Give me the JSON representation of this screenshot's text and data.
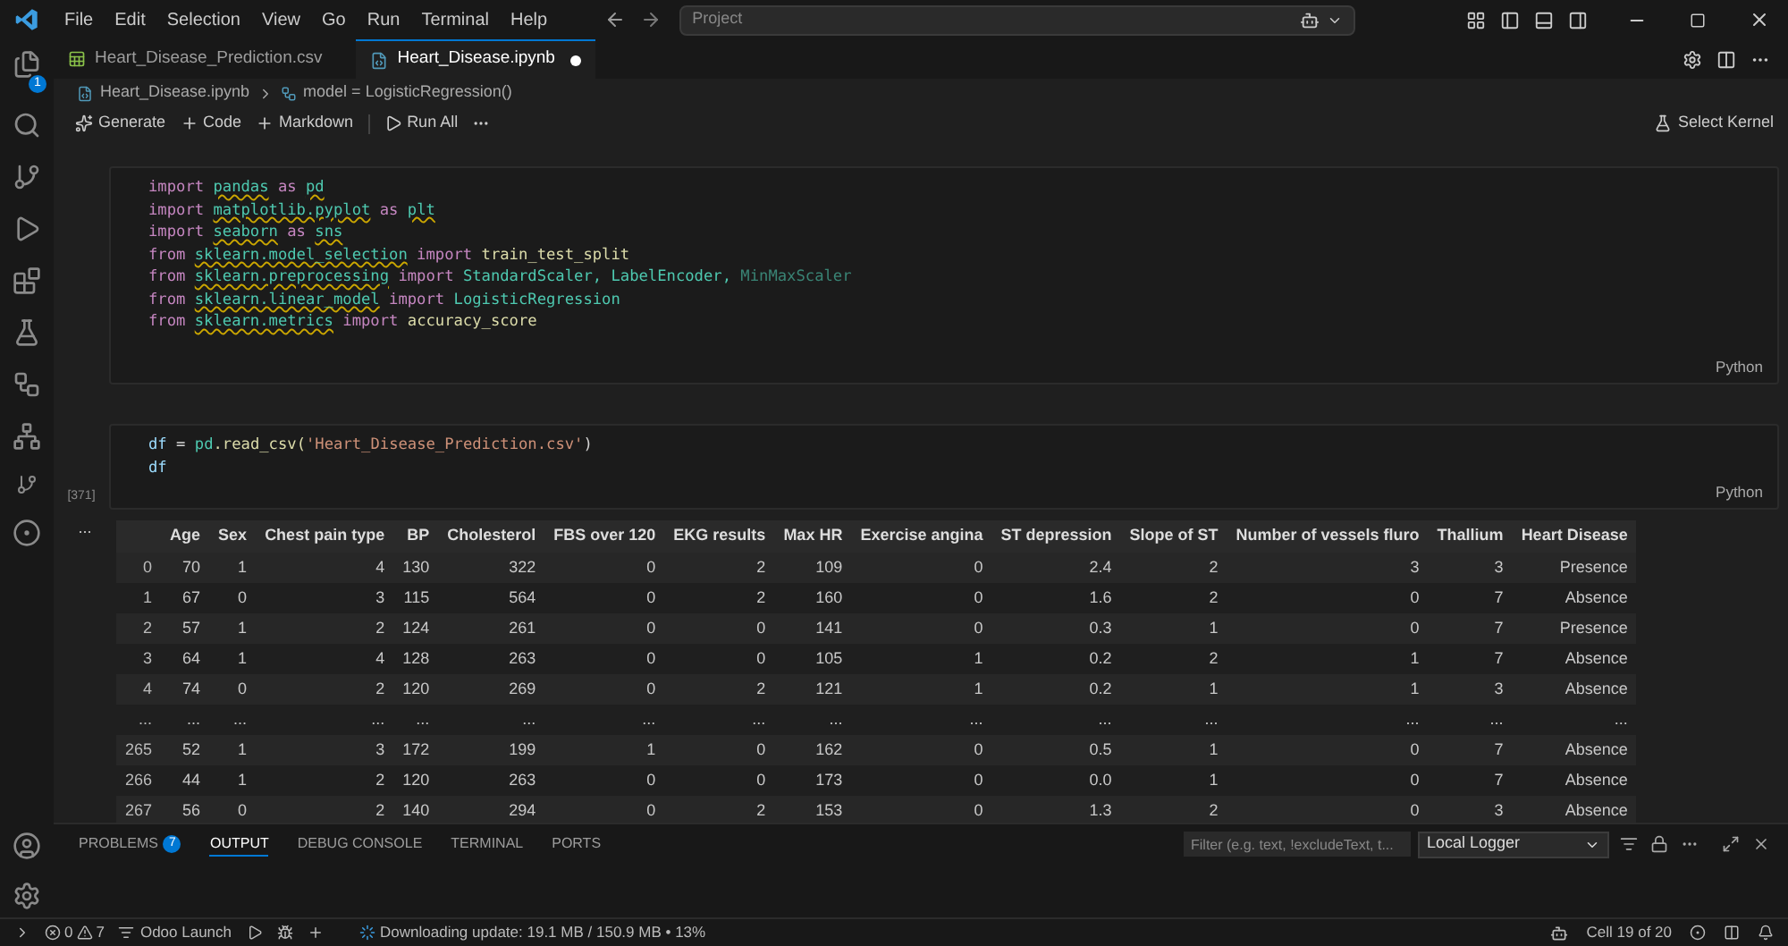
{
  "menu": [
    "File",
    "Edit",
    "Selection",
    "View",
    "Go",
    "Run",
    "Terminal",
    "Help"
  ],
  "command_center": {
    "placeholder": "Project"
  },
  "activity_bar": {
    "explorer_badge": "1"
  },
  "tabs": [
    {
      "label": "Heart_Disease_Prediction.csv",
      "kind": "csv",
      "selected": false,
      "modified": false
    },
    {
      "label": "Heart_Disease.ipynb",
      "kind": "notebook",
      "selected": true,
      "modified": true
    }
  ],
  "breadcrumb": [
    "Heart_Disease.ipynb",
    "model = LogisticRegression()"
  ],
  "toolbar": [
    "Generate",
    "Code",
    "Markdown",
    "Run All"
  ],
  "kernel": "Select Kernel",
  "cells": [
    {
      "language": "Python",
      "lines": [
        [
          {
            "text": "import ",
            "kind": "keyword"
          },
          {
            "text": "pandas",
            "kind": "module"
          },
          {
            "text": " as ",
            "kind": "keyword"
          },
          {
            "text": "pd",
            "kind": "module"
          }
        ],
        [
          {
            "text": "import ",
            "kind": "keyword"
          },
          {
            "text": "matplotlib.pyplot",
            "kind": "module"
          },
          {
            "text": " as ",
            "kind": "keyword"
          },
          {
            "text": "plt",
            "kind": "module"
          }
        ],
        [
          {
            "text": "import ",
            "kind": "keyword"
          },
          {
            "text": "seaborn",
            "kind": "module"
          },
          {
            "text": " as ",
            "kind": "keyword"
          },
          {
            "text": "sns",
            "kind": "module"
          }
        ],
        [
          {
            "text": "from ",
            "kind": "keyword"
          },
          {
            "text": "sklearn.model_selection",
            "kind": "module"
          },
          {
            "text": " import ",
            "kind": "keyword"
          },
          {
            "text": "train_test_split",
            "kind": "function"
          }
        ],
        [
          {
            "text": "from ",
            "kind": "keyword"
          },
          {
            "text": "sklearn.preprocessing",
            "kind": "module"
          },
          {
            "text": " import ",
            "kind": "keyword"
          },
          {
            "text": "StandardScaler, ",
            "kind": "class"
          },
          {
            "text": "LabelEncoder, ",
            "kind": "class"
          },
          {
            "text": "MinMaxScaler",
            "kind": "unused"
          }
        ],
        [
          {
            "text": "from ",
            "kind": "keyword"
          },
          {
            "text": "sklearn.linear_model",
            "kind": "module"
          },
          {
            "text": " import ",
            "kind": "keyword"
          },
          {
            "text": "LogisticRegression",
            "kind": "class"
          }
        ],
        [
          {
            "text": "from ",
            "kind": "keyword"
          },
          {
            "text": "sklearn.metrics",
            "kind": "module"
          },
          {
            "text": " import ",
            "kind": "keyword"
          },
          {
            "text": "accuracy_score",
            "kind": "function"
          }
        ]
      ]
    },
    {
      "language": "Python",
      "execution": "[371]",
      "lines": [
        [
          {
            "text": "df",
            "kind": "variable"
          },
          {
            "text": " = ",
            "kind": "operator"
          },
          {
            "text": "pd",
            "kind": "class"
          },
          {
            "text": ".read_csv(",
            "kind": "function"
          },
          {
            "text": "'Heart_Disease_Prediction.csv'",
            "kind": "string"
          },
          {
            "text": ")",
            "kind": "operator"
          }
        ],
        [
          {
            "text": "df",
            "kind": "variable"
          }
        ]
      ]
    }
  ],
  "output": {
    "more": "...",
    "table": {
      "columns": [
        "",
        "Age",
        "Sex",
        "Chest pain type",
        "BP",
        "Cholesterol",
        "FBS over 120",
        "EKG results",
        "Max HR",
        "Exercise angina",
        "ST depression",
        "Slope of ST",
        "Number of vessels fluro",
        "Thallium",
        "Heart Disease"
      ],
      "rows": [
        [
          "0",
          "70",
          "1",
          "4",
          "130",
          "322",
          "0",
          "2",
          "109",
          "0",
          "2.4",
          "2",
          "3",
          "3",
          "Presence"
        ],
        [
          "1",
          "67",
          "0",
          "3",
          "115",
          "564",
          "0",
          "2",
          "160",
          "0",
          "1.6",
          "2",
          "0",
          "7",
          "Absence"
        ],
        [
          "2",
          "57",
          "1",
          "2",
          "124",
          "261",
          "0",
          "0",
          "141",
          "0",
          "0.3",
          "1",
          "0",
          "7",
          "Presence"
        ],
        [
          "3",
          "64",
          "1",
          "4",
          "128",
          "263",
          "0",
          "0",
          "105",
          "1",
          "0.2",
          "2",
          "1",
          "7",
          "Absence"
        ],
        [
          "4",
          "74",
          "0",
          "2",
          "120",
          "269",
          "0",
          "2",
          "121",
          "1",
          "0.2",
          "1",
          "1",
          "3",
          "Absence"
        ],
        [
          "...",
          "...",
          "...",
          "...",
          "...",
          "...",
          "...",
          "...",
          "...",
          "...",
          "...",
          "...",
          "...",
          "...",
          "..."
        ],
        [
          "265",
          "52",
          "1",
          "3",
          "172",
          "199",
          "1",
          "0",
          "162",
          "0",
          "0.5",
          "1",
          "0",
          "7",
          "Absence"
        ],
        [
          "266",
          "44",
          "1",
          "2",
          "120",
          "263",
          "0",
          "0",
          "173",
          "0",
          "0.0",
          "1",
          "0",
          "7",
          "Absence"
        ],
        [
          "267",
          "56",
          "0",
          "2",
          "140",
          "294",
          "0",
          "2",
          "153",
          "0",
          "1.3",
          "2",
          "0",
          "3",
          "Absence"
        ]
      ]
    }
  },
  "panel": {
    "tabs": [
      {
        "label": "PROBLEMS",
        "badge": "7",
        "selected": false
      },
      {
        "label": "OUTPUT",
        "selected": true
      },
      {
        "label": "DEBUG CONSOLE",
        "selected": false
      },
      {
        "label": "TERMINAL",
        "selected": false
      },
      {
        "label": "PORTS",
        "selected": false
      }
    ],
    "filter": {
      "placeholder": "Filter (e.g. text, !excludeText, t..."
    },
    "channel": "Local Logger"
  },
  "status_bar": {
    "errors": "0",
    "warnings": "7",
    "launch": "Odoo Launch",
    "progress": "Downloading update: 19.1 MB / 150.9 MB • 13%",
    "cell": "Cell 19 of 20"
  }
}
